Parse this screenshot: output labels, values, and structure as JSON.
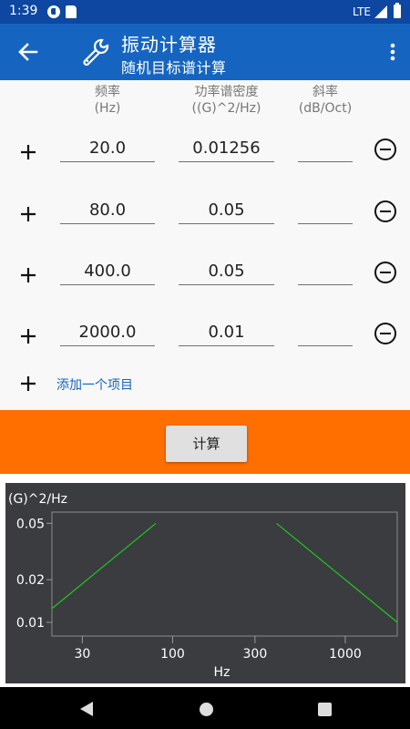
{
  "status_bar": {
    "time": "1:39",
    "network": "LTE"
  },
  "toolbar": {
    "title": "振动计算器",
    "subtitle": "随机目标谱计算",
    "back_icon": "arrow-left-icon",
    "logo_icon": "wrench-icon",
    "menu_icon": "more-vert-icon"
  },
  "table": {
    "headers": [
      {
        "label": "频率",
        "unit": "(Hz)"
      },
      {
        "label": "功率谱密度",
        "unit": "((G)^2/Hz)"
      },
      {
        "label": "斜率",
        "unit": "(dB/Oct)"
      }
    ],
    "rows": [
      {
        "freq": "20.0",
        "psd": "0.01256",
        "slope": ""
      },
      {
        "freq": "80.0",
        "psd": "0.05",
        "slope": ""
      },
      {
        "freq": "400.0",
        "psd": "0.05",
        "slope": ""
      },
      {
        "freq": "2000.0",
        "psd": "0.01",
        "slope": ""
      }
    ],
    "add_item_label": "添加一个项目"
  },
  "actions": {
    "calculate_label": "计算"
  },
  "colors": {
    "status_bar": "#0d47a1",
    "toolbar": "#1565c0",
    "accent_orange": "#ff6f00",
    "chart_background": "#3a3c3f",
    "series_line": "#21c821"
  },
  "chart_data": {
    "type": "line",
    "title": "",
    "ylabel": "(G)^2/Hz",
    "xlabel": "Hz",
    "x_scale": "log",
    "y_scale": "log",
    "xlim": [
      20,
      2000
    ],
    "ylim": [
      0.008,
      0.06
    ],
    "x_ticks": [
      30,
      100,
      300,
      1000
    ],
    "x_tick_labels": [
      "30",
      "100",
      "300",
      "1000"
    ],
    "y_ticks": [
      0.01,
      0.02,
      0.05
    ],
    "y_tick_labels": [
      "0.01",
      "0.02",
      "0.05"
    ],
    "grid": false,
    "segments": [
      {
        "x": [
          20,
          80
        ],
        "y": [
          0.0125,
          0.05
        ]
      },
      {
        "x": [
          400,
          2000
        ],
        "y": [
          0.05,
          0.01
        ]
      }
    ]
  }
}
